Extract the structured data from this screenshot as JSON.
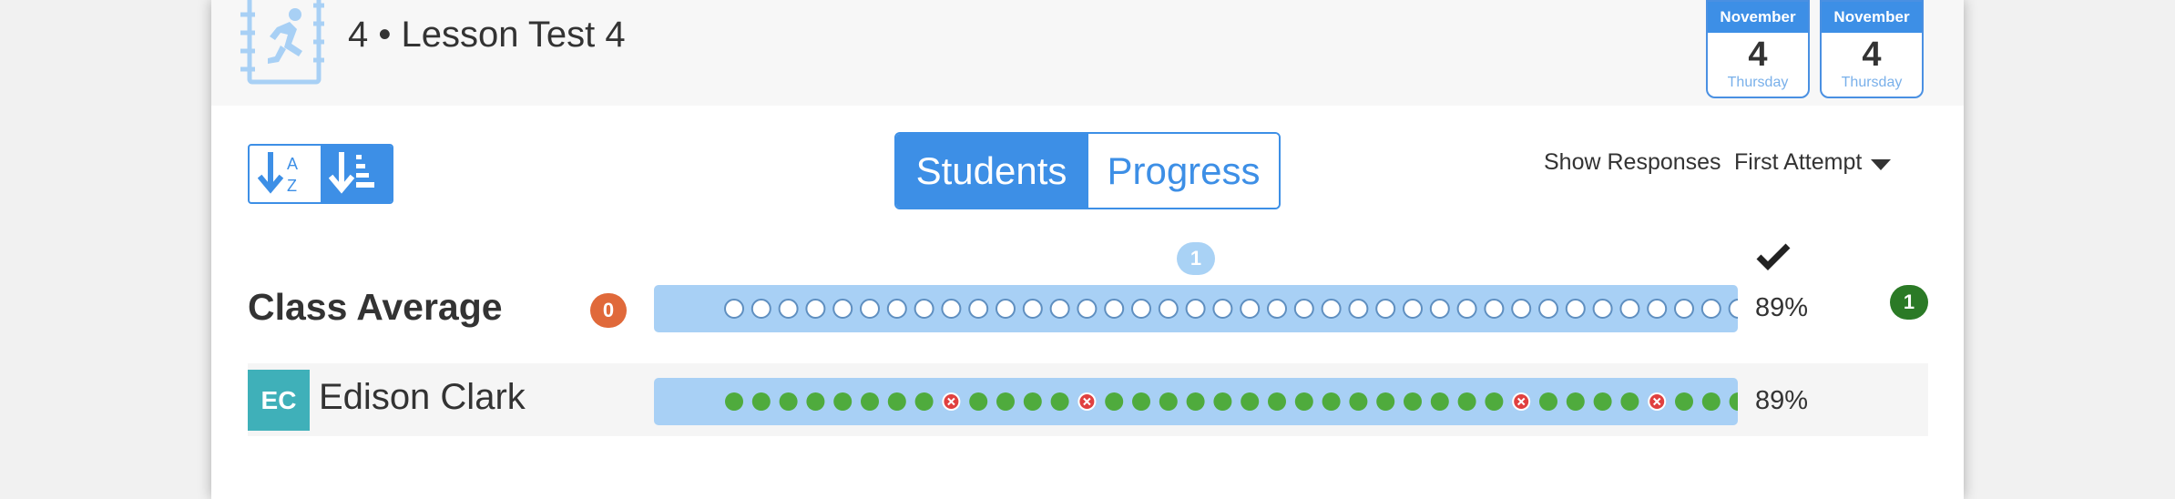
{
  "header": {
    "title": "4 • Lesson Test 4",
    "icon": "runner-notebook-icon",
    "dates": [
      {
        "month": "November",
        "day": "4",
        "weekday": "Thursday"
      },
      {
        "month": "November",
        "day": "4",
        "weekday": "Thursday"
      }
    ]
  },
  "toolbar": {
    "sort_alpha_icon": "sort-alphabetical-icon",
    "sort_score_icon": "sort-by-score-icon",
    "view_tabs": [
      {
        "label": "Students",
        "active": true
      },
      {
        "label": "Progress",
        "active": false
      }
    ],
    "show_responses_label": "Show Responses",
    "attempt_selected": "First Attempt"
  },
  "grid": {
    "question_badge": "1",
    "correct_icon": "checkmark-icon",
    "class_average": {
      "label": "Class Average",
      "badge": "0",
      "percent": "89%",
      "right_badge": "1",
      "question_count": 38
    },
    "students": [
      {
        "initials": "EC",
        "name": "Edison Clark",
        "percent": "89%",
        "results": [
          "correct",
          "correct",
          "correct",
          "correct",
          "correct",
          "correct",
          "correct",
          "correct",
          "incorrect",
          "correct",
          "correct",
          "correct",
          "correct",
          "incorrect",
          "correct",
          "correct",
          "correct",
          "correct",
          "correct",
          "correct",
          "correct",
          "correct",
          "correct",
          "correct",
          "correct",
          "correct",
          "correct",
          "correct",
          "correct",
          "incorrect",
          "correct",
          "correct",
          "correct",
          "correct",
          "incorrect",
          "correct",
          "correct",
          "correct"
        ]
      }
    ]
  },
  "colors": {
    "accent": "#3d8fe6",
    "bar": "#a8d0f5",
    "correct": "#4fab3d",
    "incorrect": "#e0403f",
    "avatar": "#3fb0b9",
    "zero_badge": "#e0693a",
    "green_badge": "#2b7a26"
  }
}
